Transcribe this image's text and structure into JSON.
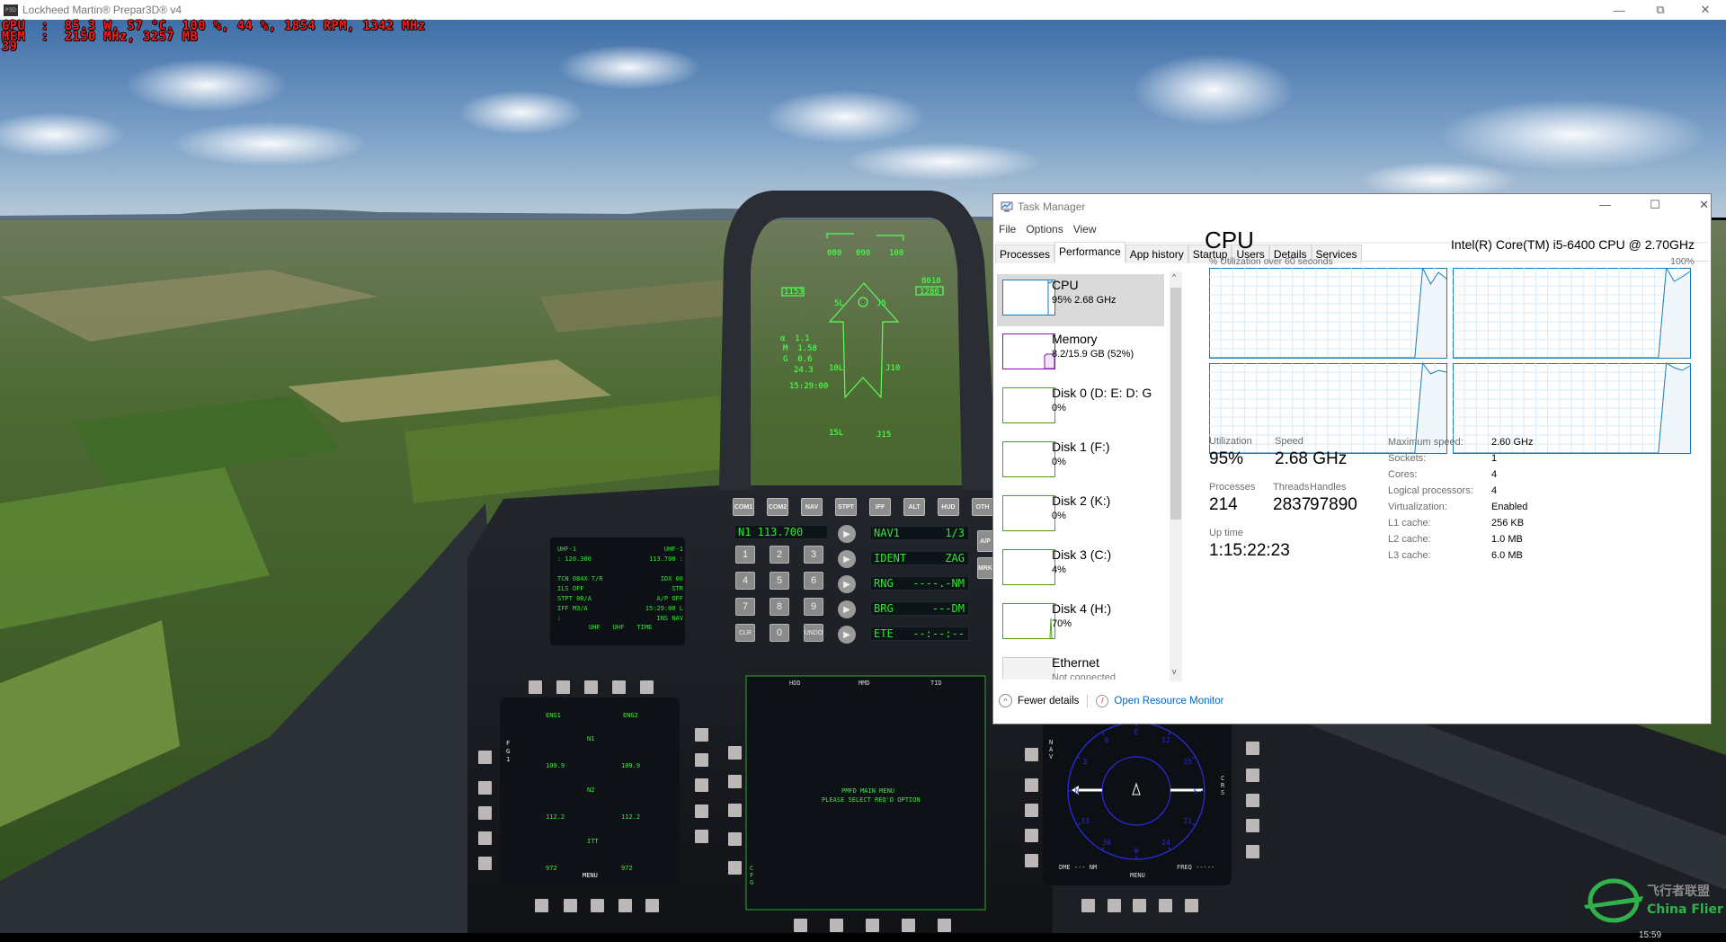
{
  "window": {
    "title": "Lockheed Martin® Prepar3D® v4",
    "icon_label": "P3D",
    "controls": [
      "minimize-icon",
      "maximize-icon",
      "close-icon"
    ]
  },
  "osd": {
    "line1": "GPU  :  85.3 W, 57 °C, 100 %, 44 %, 1854 RPM, 1342 MHz",
    "line2": "MEM  :  2150 MHz, 3257 MB",
    "line3": "39",
    "color": "#ff1a1a"
  },
  "hud": {
    "heading_ticks": [
      "080",
      "090",
      "100"
    ],
    "airspeed": "1153",
    "altitude_top": "8010",
    "altitude": "1280",
    "alpha": "α  1.1",
    "mach": "M  1.58",
    "g": "G  0.6",
    "gmax": "24.3",
    "time": "15:29:00",
    "ladder_5l": "5L",
    "ladder_5r": "J5",
    "ladder_10l": "10L",
    "ladder_10r": "J10",
    "ladder_15l": "15L",
    "ladder_15r": "J15",
    "color": "#5cff5c"
  },
  "ded": {
    "lines": [
      [
        "UHF-1",
        "UHF-1"
      ],
      [
        ": 120.300",
        "113.700 :"
      ],
      [
        "",
        ""
      ],
      [
        "TCN 084X T/R",
        "IDX 00"
      ],
      [
        "ILS OFF",
        "STR"
      ],
      [
        "STPT 00/A",
        "A/P OFF"
      ],
      [
        "IFF M3/A",
        "15:29:00 L"
      ],
      [
        ":",
        "INS NAV"
      ]
    ],
    "softkeys": [
      "UHF",
      "UHF",
      "TIME"
    ]
  },
  "ufc": {
    "top_buttons": [
      "COM1",
      "COM2",
      "NAV",
      "STPT",
      "IFF",
      "ALT",
      "HUD",
      "OTH"
    ],
    "scratchpad": "N1 113.700",
    "keys": [
      "1",
      "2",
      "3",
      "4",
      "5",
      "6",
      "7",
      "8",
      "9",
      "CLR",
      "0",
      "UNDO"
    ],
    "displays": [
      [
        "NAV1",
        "1/3"
      ],
      [
        "IDENT",
        "ZAG"
      ],
      [
        "RNG",
        "----.-NM"
      ],
      [
        "BRG",
        "---DM"
      ],
      [
        "ETE",
        "--:--:--"
      ]
    ],
    "side_buttons": [
      "A/P",
      "MRK"
    ]
  },
  "engine_mfd": {
    "side_label": "FG1",
    "eng1": "ENG1",
    "eng2": "ENG2",
    "rows": [
      {
        "label": "N1",
        "left": "109.9",
        "right": "109.9"
      },
      {
        "label": "N2",
        "left": "112.2",
        "right": "112.2"
      },
      {
        "label": "ITT",
        "left": "972",
        "right": "972"
      }
    ],
    "menu": "MENU"
  },
  "main_mfd": {
    "top_labels": [
      "HDD",
      "MMD",
      "TID"
    ],
    "title": "PMFD MAIN MENU",
    "subtitle": "PLEASE SELECT REQ'D OPTION",
    "side_label": "CFG"
  },
  "hsi_mfd": {
    "side_label": "NAV",
    "crs_label": "CRS",
    "compass": [
      "E",
      "12",
      "15",
      "S",
      "21",
      "24",
      "W",
      "30",
      "33",
      "N",
      "3",
      "6"
    ],
    "dme": "DME --- NM",
    "freq": "FREQ -----",
    "menu": "MENU",
    "color": "#2b2bd8"
  },
  "watermark": {
    "cn": "飞行者联盟",
    "en": "China Flier",
    "color": "#2fb24a"
  },
  "taskbar": {
    "clock": "15:59"
  },
  "task_manager": {
    "title": "Task Manager",
    "window_controls": [
      "minimize-icon",
      "maximize-icon",
      "close-icon"
    ],
    "menu": [
      "File",
      "Options",
      "View"
    ],
    "tabs": [
      "Processes",
      "Performance",
      "App history",
      "Startup",
      "Users",
      "Details",
      "Services"
    ],
    "active_tab": "Performance",
    "resources": [
      {
        "name": "CPU",
        "sub": "95% 2.68 GHz",
        "color": "#117dbb",
        "selected": true
      },
      {
        "name": "Memory",
        "sub": "8.2/15.9 GB (52%)",
        "color": "#8b12ae"
      },
      {
        "name": "Disk 0 (D: E: D: G",
        "sub": "0%",
        "color": "#4da60c"
      },
      {
        "name": "Disk 1 (F:)",
        "sub": "0%",
        "color": "#4da60c"
      },
      {
        "name": "Disk 2 (K:)",
        "sub": "0%",
        "color": "#4da60c"
      },
      {
        "name": "Disk 3 (C:)",
        "sub": "4%",
        "color": "#4da60c"
      },
      {
        "name": "Disk 4 (H:)",
        "sub": "70%",
        "color": "#4da60c"
      },
      {
        "name": "Ethernet",
        "sub": "Not connected",
        "color": "#a0a0a0"
      }
    ],
    "cpu": {
      "heading": "CPU",
      "model": "Intel(R) Core(TM) i5-6400 CPU @ 2.70GHz",
      "graph_label": "% Utilization over 60 seconds",
      "graph_max": "100%",
      "graph_color": "#117dbb",
      "cores_history": [
        [
          0,
          0,
          0,
          0,
          0,
          0,
          0,
          0,
          0,
          0,
          0,
          0,
          0,
          0,
          0,
          0,
          0,
          0,
          0,
          0,
          0,
          0,
          0,
          0,
          0,
          0,
          0,
          100,
          82,
          95,
          88
        ],
        [
          0,
          0,
          0,
          0,
          0,
          0,
          0,
          0,
          0,
          0,
          0,
          0,
          0,
          0,
          0,
          0,
          0,
          0,
          0,
          0,
          0,
          0,
          0,
          0,
          0,
          0,
          0,
          100,
          85,
          90,
          96
        ],
        [
          0,
          0,
          0,
          0,
          0,
          0,
          0,
          0,
          0,
          0,
          0,
          0,
          0,
          0,
          0,
          0,
          0,
          0,
          0,
          0,
          0,
          0,
          0,
          0,
          0,
          0,
          0,
          100,
          88,
          92,
          90
        ],
        [
          0,
          0,
          0,
          0,
          0,
          0,
          0,
          0,
          0,
          0,
          0,
          0,
          0,
          0,
          0,
          0,
          0,
          0,
          0,
          0,
          0,
          0,
          0,
          0,
          0,
          0,
          0,
          100,
          95,
          92,
          97
        ]
      ],
      "stats": {
        "utilization_label": "Utilization",
        "utilization": "95%",
        "speed_label": "Speed",
        "speed": "2.68 GHz",
        "processes_label": "Processes",
        "processes": "214",
        "threads_label": "Threads",
        "threads": "2837",
        "handles_label": "Handles",
        "handles": "97890",
        "uptime_label": "Up time",
        "uptime": "1:15:22:23"
      },
      "specs": [
        [
          "Maximum speed:",
          "2.60 GHz"
        ],
        [
          "Sockets:",
          "1"
        ],
        [
          "Cores:",
          "4"
        ],
        [
          "Logical processors:",
          "4"
        ],
        [
          "Virtualization:",
          "Enabled"
        ],
        [
          "L1 cache:",
          "256 KB"
        ],
        [
          "L2 cache:",
          "1.0 MB"
        ],
        [
          "L3 cache:",
          "6.0 MB"
        ]
      ]
    },
    "footer": {
      "fewer_details": "Fewer details",
      "resource_monitor": "Open Resource Monitor"
    }
  }
}
